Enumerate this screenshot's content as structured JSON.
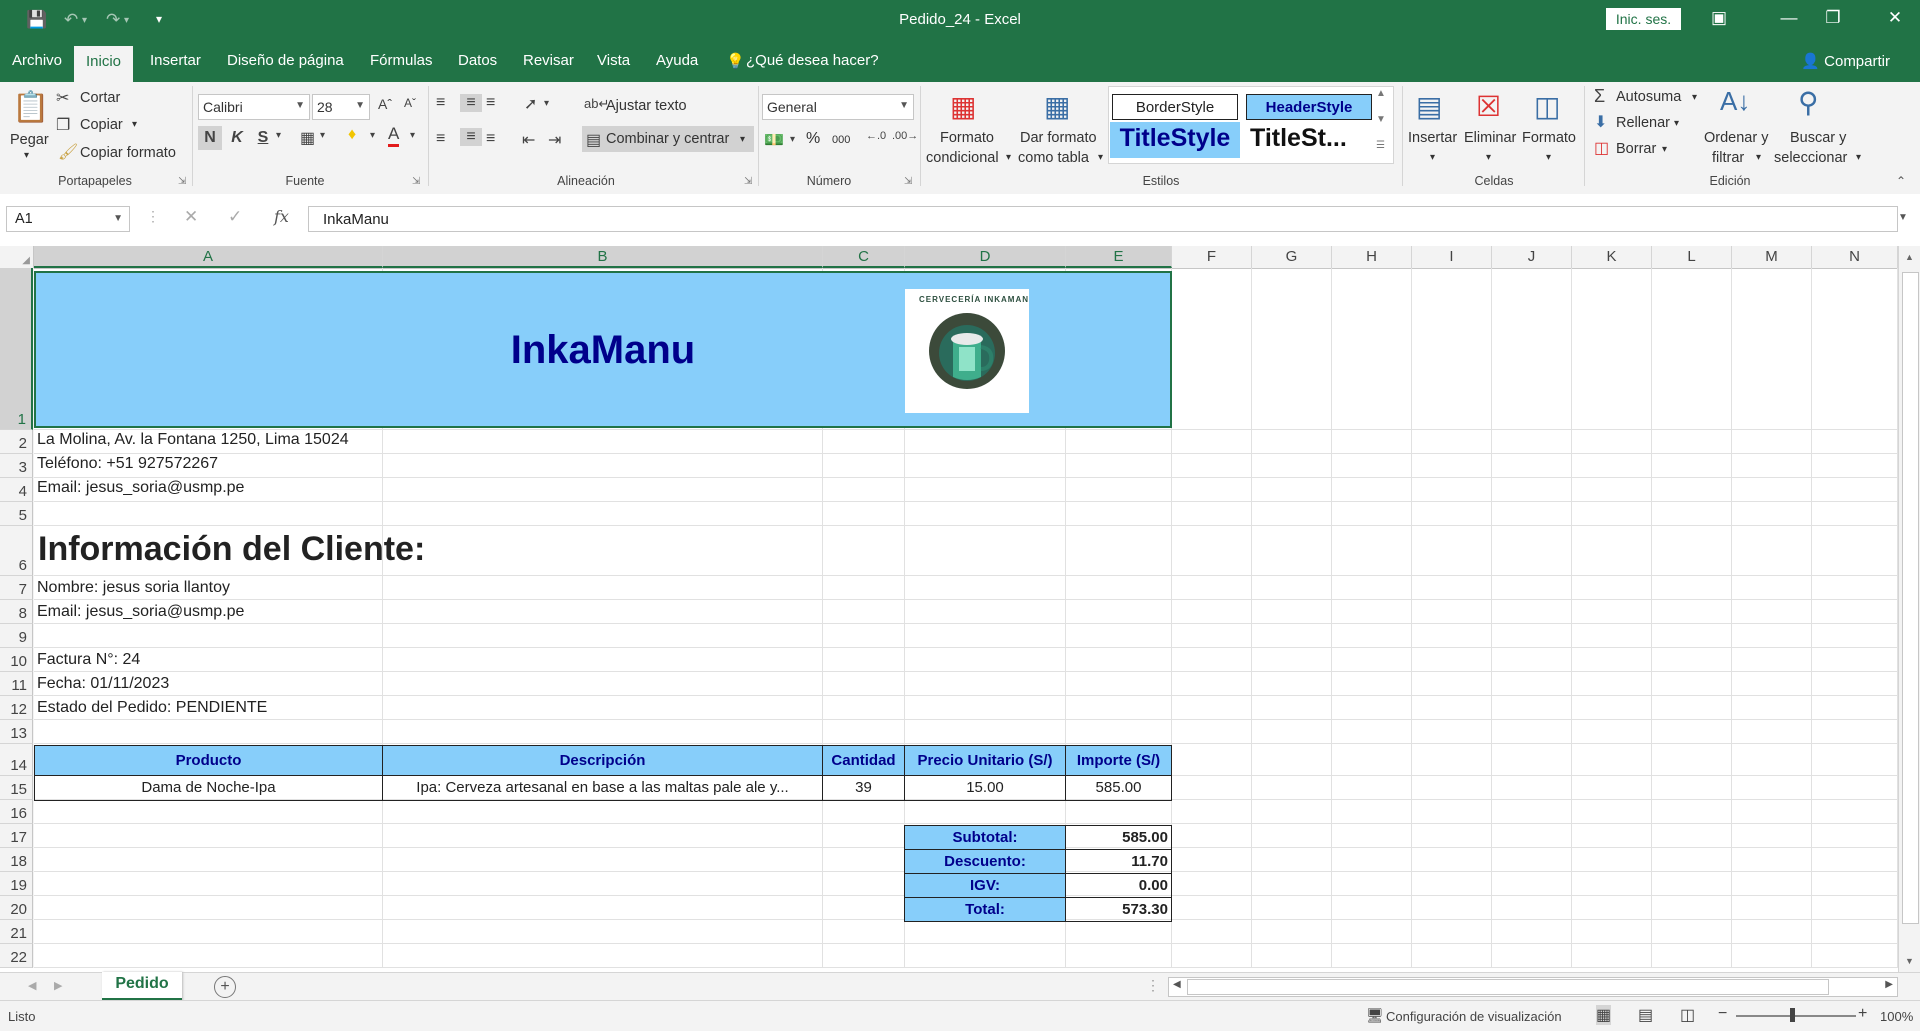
{
  "window": {
    "title": "Pedido_24  -  Excel",
    "signin": "Inic. ses.",
    "undo_icon": "undo-icon",
    "redo_icon": "redo-icon",
    "save_icon": "save-icon"
  },
  "tabs": [
    "Archivo",
    "Inicio",
    "Insertar",
    "Diseño de página",
    "Fórmulas",
    "Datos",
    "Revisar",
    "Vista",
    "Ayuda"
  ],
  "active_tab": "Inicio",
  "tell_me": "¿Qué desea hacer?",
  "share": "Compartir",
  "ribbon": {
    "clipboard": {
      "paste": "Pegar",
      "cut": "Cortar",
      "copy": "Copiar",
      "format_painter": "Copiar formato",
      "label": "Portapapeles"
    },
    "font": {
      "name": "Calibri",
      "size": "28",
      "bold": "N",
      "italic": "K",
      "underline": "S",
      "label": "Fuente"
    },
    "alignment": {
      "wrap": "Ajustar texto",
      "merge": "Combinar y centrar",
      "label": "Alineación"
    },
    "number": {
      "format": "General",
      "percent": "%",
      "thousands": "000",
      "label": "Número"
    },
    "styles": {
      "conditional": [
        "Formato",
        "condicional"
      ],
      "as_table": [
        "Dar formato",
        "como tabla"
      ],
      "gallery": [
        "BorderStyle",
        "HeaderStyle",
        "TitleStyle",
        "TitleSt..."
      ],
      "label": "Estilos"
    },
    "cells": {
      "insert": "Insertar",
      "delete": "Eliminar",
      "format": "Formato",
      "label": "Celdas"
    },
    "editing": {
      "autosum": "Autosuma",
      "fill": "Rellenar",
      "clear": "Borrar",
      "sort": [
        "Ordenar y",
        "filtrar"
      ],
      "find": [
        "Buscar y",
        "seleccionar"
      ],
      "label": "Edición"
    }
  },
  "formula_bar": {
    "name_box": "A1",
    "fx": "fx",
    "content": "InkaManu"
  },
  "columns": [
    "A",
    "B",
    "C",
    "D",
    "E",
    "F",
    "G",
    "H",
    "I",
    "J",
    "K",
    "L",
    "M",
    "N"
  ],
  "rows": [
    "1",
    "2",
    "3",
    "4",
    "5",
    "6",
    "7",
    "8",
    "9",
    "10",
    "11",
    "12",
    "13",
    "14",
    "15",
    "16",
    "17",
    "18",
    "19",
    "20",
    "21",
    "22"
  ],
  "sheet": {
    "title": "InkaManu",
    "logo_text": "CERVECERÍA INKAMANU",
    "address": "La Molina, Av. la Fontana 1250, Lima 15024",
    "phone": "Teléfono: +51 927572267",
    "email": "Email: jesus_soria@usmp.pe",
    "client_heading": "Información del Cliente:",
    "client_name": "Nombre: jesus soria llantoy",
    "client_email": "Email: jesus_soria@usmp.pe",
    "invoice": "Factura N°: 24",
    "date": "Fecha: 01/11/2023",
    "status": "Estado del Pedido: PENDIENTE",
    "table_headers": [
      "Producto",
      "Descripción",
      "Cantidad",
      "Precio Unitario (S/)",
      "Importe (S/)"
    ],
    "table_row": [
      "Dama de Noche-Ipa",
      "Ipa:  Cerveza artesanal en base a las maltas pale ale y...",
      "39",
      "15.00",
      "585.00"
    ],
    "totals": [
      {
        "label": "Subtotal:",
        "value": "585.00"
      },
      {
        "label": "Descuento:",
        "value": "11.70"
      },
      {
        "label": "IGV:",
        "value": "0.00"
      },
      {
        "label": "Total:",
        "value": "573.30"
      }
    ]
  },
  "sheet_tab": "Pedido",
  "status": {
    "ready": "Listo",
    "display_settings": "Configuración de visualización",
    "zoom": "100%"
  },
  "colors": {
    "excel_green": "#217346",
    "header_fill": "#87cefa",
    "title_text": "#00008b"
  }
}
